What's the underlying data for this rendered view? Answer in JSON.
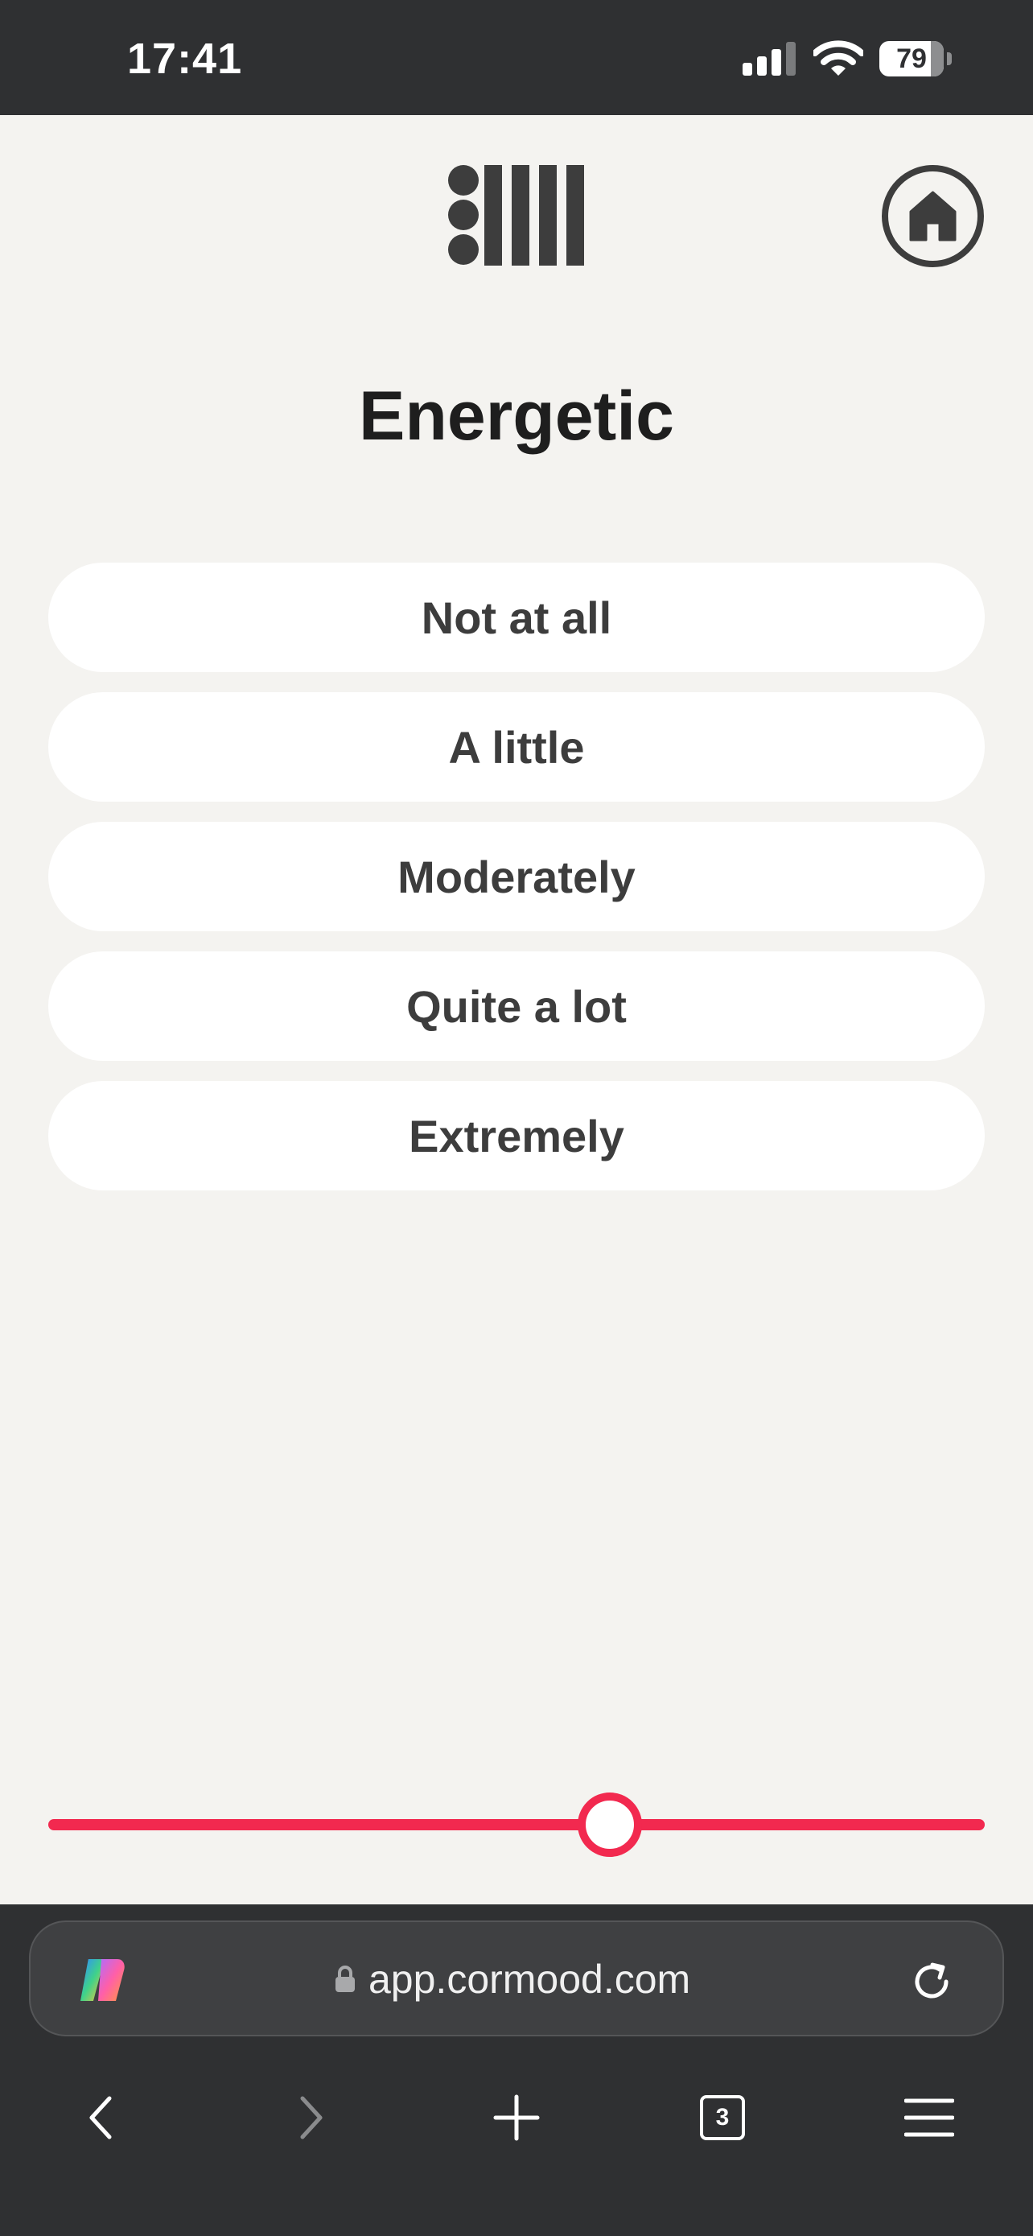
{
  "status_bar": {
    "time": "17:41",
    "battery": "79"
  },
  "header": {
    "logo_icon": "brand-logo-icon",
    "home_icon": "home-icon"
  },
  "question": {
    "title": "Energetic"
  },
  "options": [
    {
      "label": "Not at all"
    },
    {
      "label": "A little"
    },
    {
      "label": "Moderately"
    },
    {
      "label": "Quite a lot"
    },
    {
      "label": "Extremely"
    }
  ],
  "slider": {
    "value": 0.6,
    "accent": "#f2294f"
  },
  "browser": {
    "url": "app.cormood.com",
    "tab_count": "3",
    "icons": [
      "copilot-icon",
      "lock-icon",
      "reload-icon",
      "back-icon",
      "forward-icon",
      "new-tab-icon",
      "tabs-icon",
      "menu-icon"
    ]
  },
  "colors": {
    "background": "#f4f3f0",
    "text": "#3d3d3d",
    "chrome": "#2f3032"
  }
}
